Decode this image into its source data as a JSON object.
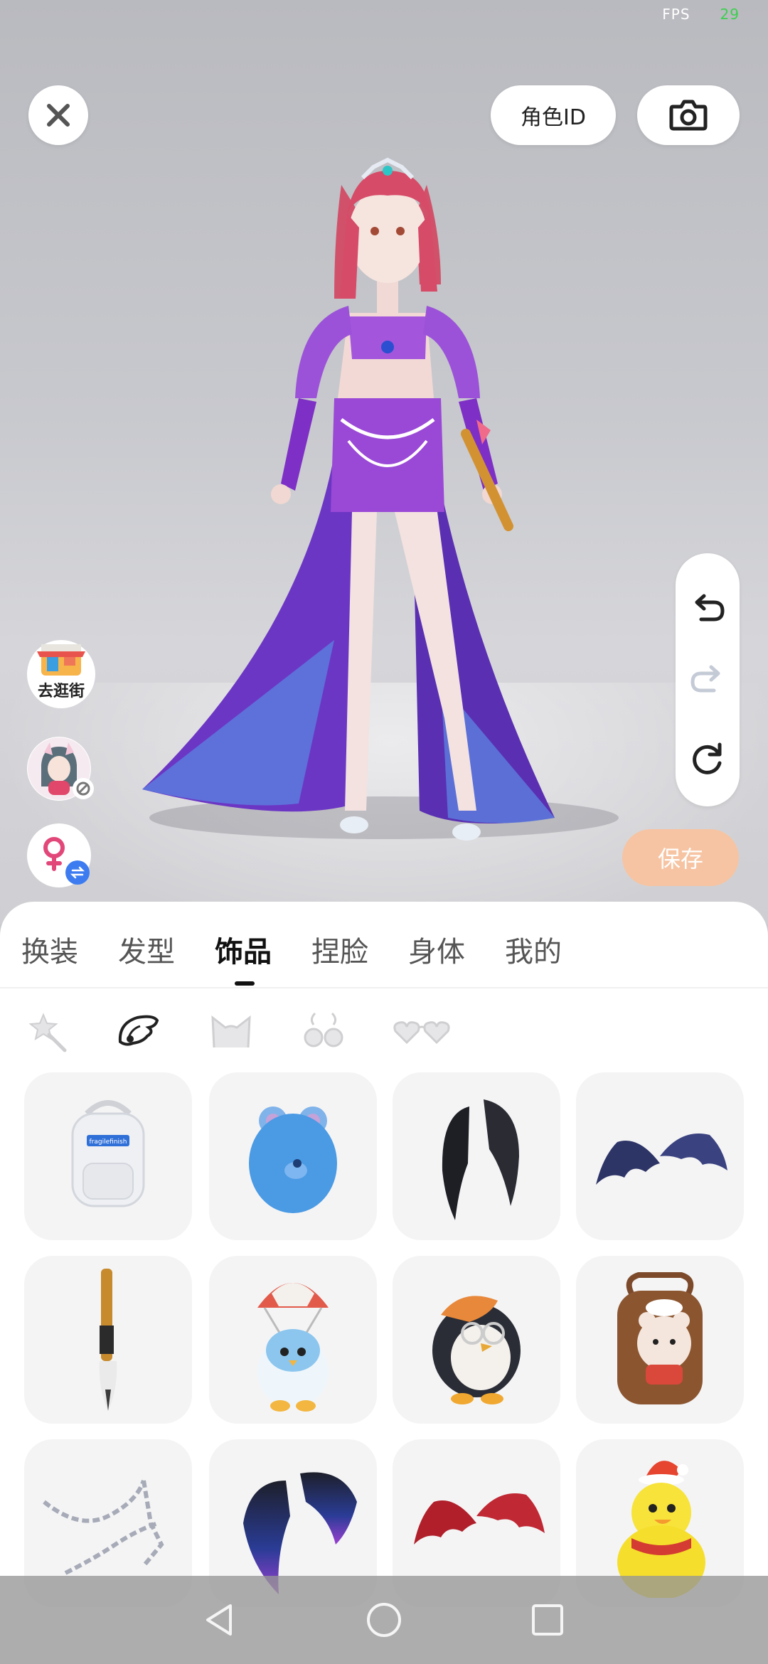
{
  "status": {
    "fps_label": "FPS",
    "fps_value": "29"
  },
  "header": {
    "role_id_label": "角色ID"
  },
  "side": {
    "shop_label": "去逛街"
  },
  "actions": {
    "save_label": "保存"
  },
  "tabs": [
    {
      "label": "换装",
      "active": false
    },
    {
      "label": "发型",
      "active": false
    },
    {
      "label": "饰品",
      "active": true
    },
    {
      "label": "捏脸",
      "active": false
    },
    {
      "label": "身体",
      "active": false
    },
    {
      "label": "我的",
      "active": false
    }
  ],
  "subcategories": [
    "star-wand-icon",
    "wing-icon",
    "ears-icon",
    "earrings-icon",
    "glasses-icon"
  ],
  "items": [
    "backpack-white",
    "bear-backpack-blue",
    "wings-black-feather",
    "wings-bat-navy",
    "calligraphy-brush",
    "parachute-chick",
    "penguin-backpack",
    "bear-backpack-brown",
    "chain-accessory",
    "wings-dark-gradient",
    "wings-bat-red",
    "duck-santa-hat"
  ],
  "backpack_print": "fragilefinish",
  "colors": {
    "accent_save": "#f6c4a2",
    "fps_green": "#3ccf4e",
    "dress_purple": "#8a3fd0"
  }
}
